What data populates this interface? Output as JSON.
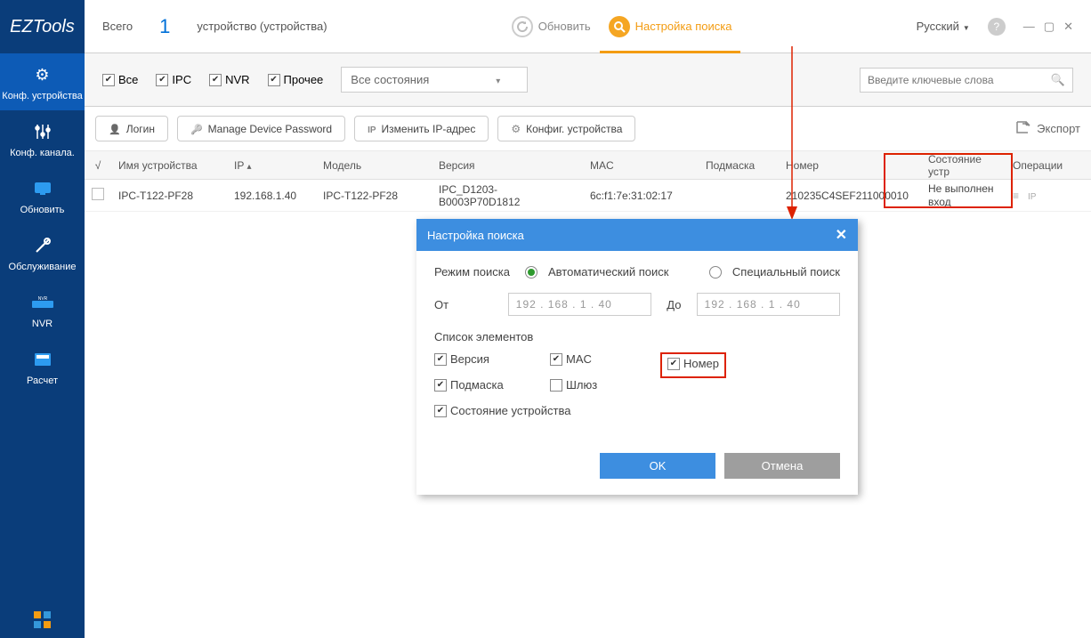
{
  "app": {
    "name": "EZTools"
  },
  "sidebar": {
    "items": [
      {
        "label": "Конф. устройства",
        "icon": "gear"
      },
      {
        "label": "Конф. канала.",
        "icon": "sliders"
      },
      {
        "label": "Обновить",
        "icon": "refresh"
      },
      {
        "label": "Обслуживание",
        "icon": "tools"
      },
      {
        "label": "NVR",
        "icon": "nvr"
      },
      {
        "label": "Расчет",
        "icon": "calc"
      }
    ]
  },
  "header": {
    "total_label": "Всего",
    "total_count": "1",
    "devices_label": "устройство (устройства)",
    "refresh": "Обновить",
    "search_settings": "Настройка поиска",
    "language": "Русский"
  },
  "filters": {
    "all": "Все",
    "ipc": "IPC",
    "nvr": "NVR",
    "other": "Прочее",
    "status_all": "Все состояния",
    "search_placeholder": "Введите ключевые слова"
  },
  "toolbar": {
    "login": "Логин",
    "manage_pw": "Manage Device Password",
    "change_ip": "Изменить IP-адрес",
    "config": "Конфиг. устройства",
    "export": "Экспорт"
  },
  "table": {
    "headers": {
      "chk": "√",
      "name": "Имя устройства",
      "ip": "IP",
      "model": "Модель",
      "version": "Версия",
      "mac": "MAC",
      "submask": "Подмаска",
      "serial": "Номер",
      "status": "Состояние устр",
      "ops": "Операции"
    },
    "rows": [
      {
        "name": "IPC-T122-PF28",
        "ip": "192.168.1.40",
        "model": "IPC-T122-PF28",
        "version": "IPC_D1203-B0003P70D1812",
        "mac": "6c:f1:7e:31:02:17",
        "submask": "",
        "serial": "210235C4SEF211000010",
        "status": "Не выполнен вход"
      }
    ]
  },
  "dialog": {
    "title": "Настройка поиска",
    "mode_label": "Режим поиска",
    "mode_auto": "Автоматический поиск",
    "mode_special": "Специальный поиск",
    "from_label": "От",
    "to_label": "До",
    "ip_from": "192 . 168 .   1  .  40",
    "ip_to": "192 . 168 .   1  .  40",
    "list_label": "Список элементов",
    "chk_version": "Версия",
    "chk_mac": "MAC",
    "chk_serial": "Номер",
    "chk_submask": "Подмаска",
    "chk_gateway": "Шлюз",
    "chk_devstate": "Состояние устройства",
    "ok": "OK",
    "cancel": "Отмена"
  }
}
